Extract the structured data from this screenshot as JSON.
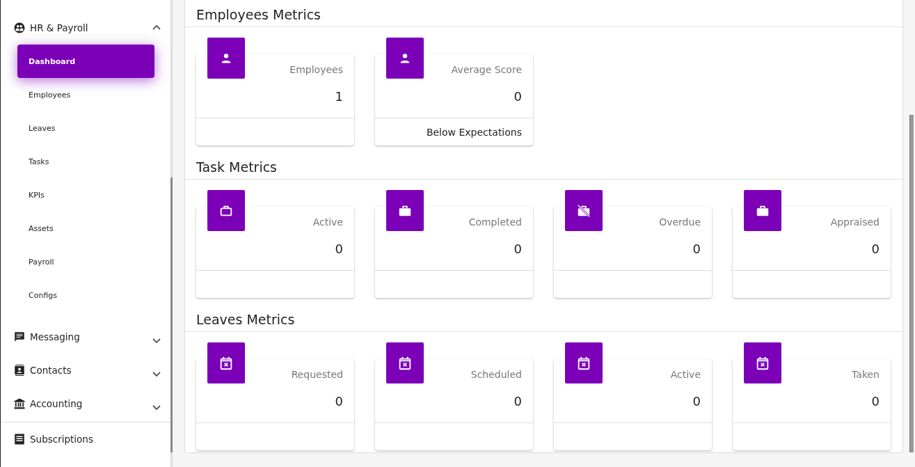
{
  "sidebar": {
    "groups": [
      {
        "label": "HR & Payroll",
        "kind": "people",
        "expanded": true,
        "children": [
          {
            "label": "Dashboard",
            "selected": true
          },
          {
            "label": "Employees",
            "selected": false
          },
          {
            "label": "Leaves",
            "selected": false
          },
          {
            "label": "Tasks",
            "selected": false
          },
          {
            "label": "KPIs",
            "selected": false
          },
          {
            "label": "Assets",
            "selected": false
          },
          {
            "label": "Payroll",
            "selected": false
          },
          {
            "label": "Configs",
            "selected": false
          }
        ]
      },
      {
        "label": "Messaging",
        "kind": "chat",
        "expanded": false
      },
      {
        "label": "Contacts",
        "kind": "contact",
        "expanded": false
      },
      {
        "label": "Accounting",
        "kind": "bank",
        "expanded": false
      }
    ],
    "items": [
      {
        "label": "Subscriptions",
        "kind": "list"
      }
    ]
  },
  "sections": [
    {
      "title": "Employees Metrics",
      "cards": [
        {
          "kind": "person",
          "label": "Employees",
          "value": "1"
        },
        {
          "kind": "person",
          "label": "Average Score",
          "value": "0",
          "footer": "Below Expectations"
        }
      ]
    },
    {
      "title": "Task Metrics",
      "cards": [
        {
          "kind": "briefcase-outline",
          "label": "Active",
          "value": "0"
        },
        {
          "kind": "briefcase",
          "label": "Completed",
          "value": "0"
        },
        {
          "kind": "briefcase-off",
          "label": "Overdue",
          "value": "0"
        },
        {
          "kind": "briefcase",
          "label": "Appraised",
          "value": "0"
        }
      ]
    },
    {
      "title": "Leaves Metrics",
      "cards": [
        {
          "kind": "calendar-x",
          "label": "Requested",
          "value": "0"
        },
        {
          "kind": "calendar-x",
          "label": "Scheduled",
          "value": "0"
        },
        {
          "kind": "calendar-x",
          "label": "Active",
          "value": "0"
        },
        {
          "kind": "calendar-x",
          "label": "Taken",
          "value": "0"
        }
      ]
    }
  ]
}
